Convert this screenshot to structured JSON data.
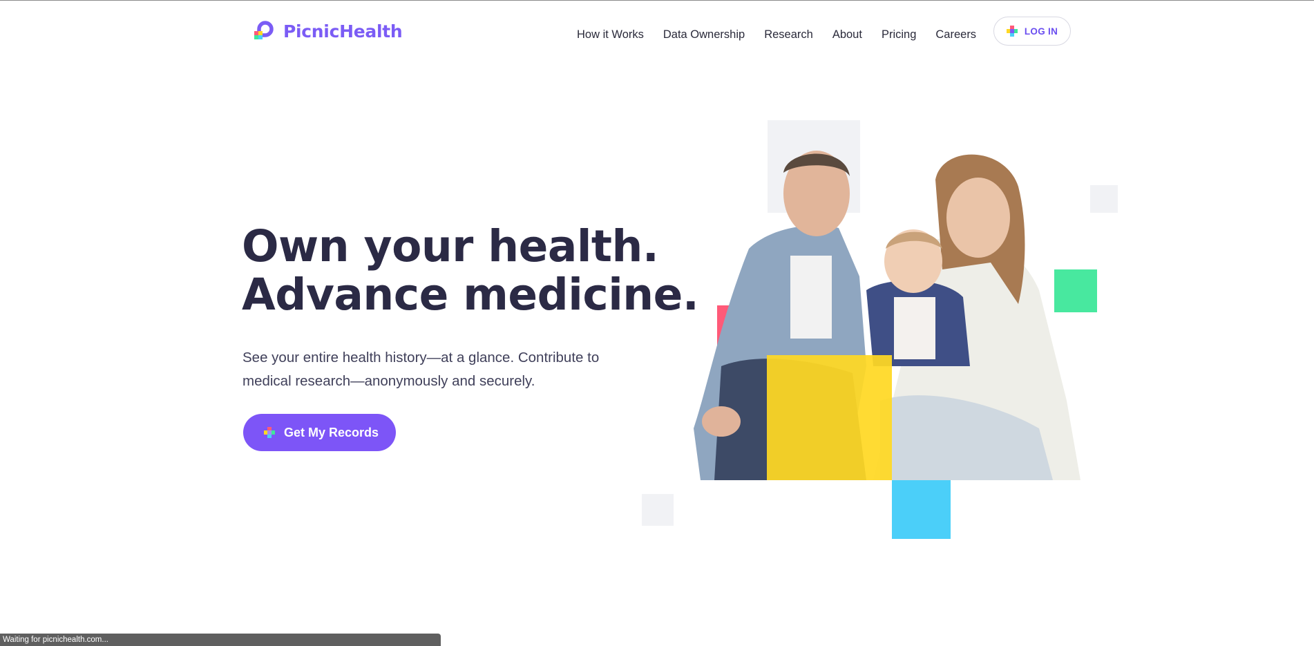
{
  "brand": {
    "name": "PicnicHealth",
    "color": "#7b5cf5"
  },
  "nav": {
    "items": [
      {
        "label": "How it Works"
      },
      {
        "label": "Data Ownership"
      },
      {
        "label": "Research"
      },
      {
        "label": "About"
      },
      {
        "label": "Pricing"
      },
      {
        "label": "Careers"
      }
    ],
    "login_label": "LOG IN"
  },
  "hero": {
    "headline_line1": "Own your health.",
    "headline_line2": "Advance medicine.",
    "subtext": "See your entire health history—at a glance. Contribute to medical research—anonymously and securely.",
    "cta_label": "Get My Records",
    "image": "family-photo"
  },
  "colors": {
    "accent": "#7d55f7",
    "heading": "#2b2a45",
    "square_pink": "#ff5a78",
    "square_yellow": "#ffd824",
    "square_green": "#3ee79a",
    "square_blue": "#4bcff9",
    "square_gray": "#f1f2f5"
  },
  "status_bar": {
    "text": "Waiting for picnichealth.com..."
  }
}
